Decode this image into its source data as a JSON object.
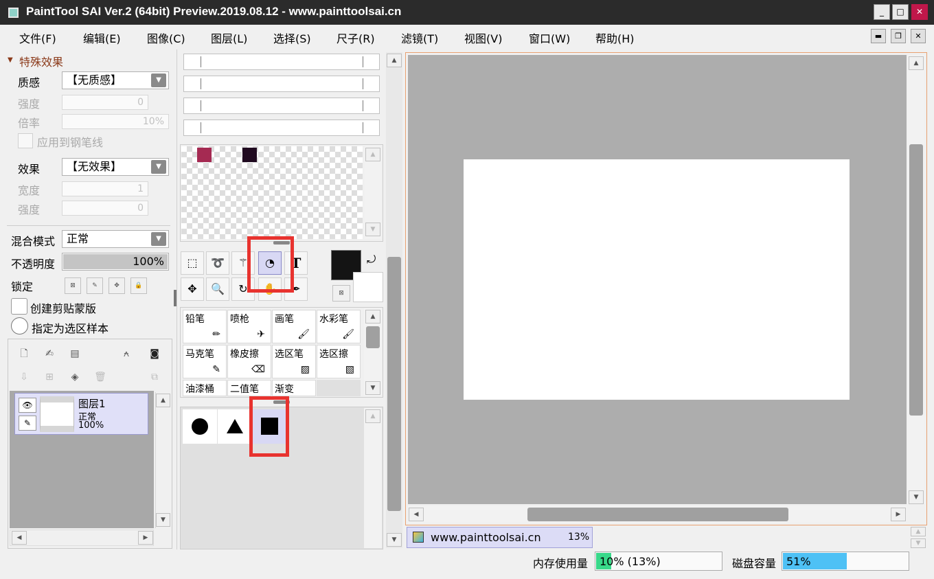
{
  "window": {
    "title": "PaintTool SAI Ver.2 (64bit) Preview.2019.08.12 - www.painttoolsai.cn",
    "minimize": "_",
    "maximize": "□",
    "close": "✕"
  },
  "menu": [
    "文件(F)",
    "编辑(E)",
    "图像(C)",
    "图层(L)",
    "选择(S)",
    "尺子(R)",
    "滤镜(T)",
    "视图(V)",
    "窗口(W)",
    "帮助(H)"
  ],
  "special_effects": {
    "header": "特殊效果",
    "texture_label": "质感",
    "texture_value": "【无质感】",
    "strength_label": "强度",
    "strength_value": "0",
    "scale_label": "倍率",
    "scale_value": "10%",
    "apply_pen_label": "应用到钢笔线",
    "effect_label": "效果",
    "effect_value": "【无效果】",
    "width_label": "宽度",
    "width_value": "1",
    "strength2_label": "强度",
    "strength2_value": "0"
  },
  "layer_props": {
    "blend_label": "混合模式",
    "blend_value": "正常",
    "opacity_label": "不透明度",
    "opacity_value": "100%",
    "opacity_level": 1.0,
    "lock_label": "锁定",
    "clip_label": "创建剪贴蒙版",
    "sample_label": "指定为选区样本"
  },
  "layer": {
    "name": "图层1",
    "mode": "正常",
    "opacity": "100%"
  },
  "swatches": [
    "#a52a52",
    "#200a20"
  ],
  "colors": {
    "foreground": "#141414",
    "background": "#ffffff",
    "accent_red": "#e8332f",
    "memory_bar": "#39d98a",
    "disk_bar": "#4ec1f5"
  },
  "tools": {
    "row1": [
      "rect-select",
      "lasso",
      "magic-wand",
      "shape",
      "text"
    ],
    "row2": [
      "move",
      "zoom",
      "rotate",
      "hand",
      "eyedropper"
    ]
  },
  "brushes": [
    "铅笔",
    "喷枪",
    "画笔",
    "水彩笔",
    "马克笔",
    "橡皮擦",
    "选区笔",
    "选区擦",
    "油漆桶",
    "二值笔",
    "渐变"
  ],
  "shapes": [
    "circle",
    "triangle",
    "square"
  ],
  "document": {
    "name": "www.painttoolsai.cn",
    "zoom": "13%"
  },
  "status": {
    "memory_label": "内存使用量",
    "memory_value": "10% (13%)",
    "memory_level": 0.1,
    "disk_label": "磁盘容量",
    "disk_value": "51%",
    "disk_level": 0.51
  }
}
